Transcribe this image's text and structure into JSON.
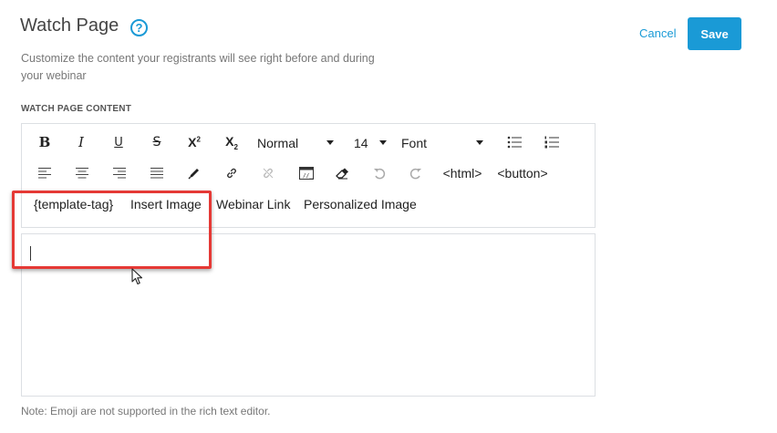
{
  "header": {
    "title": "Watch Page",
    "subtitle": "Customize the content your registrants will see right before and during your webinar",
    "help_icon_glyph": "?",
    "cancel_label": "Cancel",
    "save_label": "Save"
  },
  "section_label": "WATCH PAGE CONTENT",
  "toolbar": {
    "bold": "B",
    "italic": "I",
    "underline": "U",
    "strike": "S",
    "superscript_base": "X",
    "superscript_sup": "2",
    "subscript_base": "X",
    "subscript_sub": "2",
    "format_value": "Normal",
    "size_value": "14",
    "font_value": "Font",
    "html_label": "<html>",
    "button_label": "<button>",
    "template_tag_label": "{template-tag}",
    "insert_image_label": "Insert Image",
    "webinar_link_label": "Webinar Link",
    "personalized_image_label": "Personalized Image"
  },
  "note": "Note: Emoji are not supported in the rich text editor.",
  "colors": {
    "accent": "#1a9ad6",
    "highlight": "#e53935",
    "border": "#dcdfe3"
  }
}
